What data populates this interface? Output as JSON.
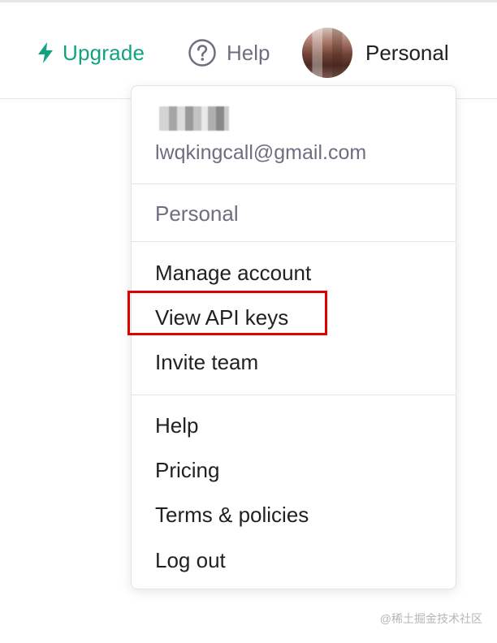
{
  "header": {
    "upgrade_label": "Upgrade",
    "help_label": "Help",
    "profile_label": "Personal",
    "upgrade_color": "#10a37f"
  },
  "menu": {
    "email": "lwqkingcall@gmail.com",
    "organization": "Personal",
    "items": [
      {
        "label": "Manage account"
      },
      {
        "label": "View API keys"
      },
      {
        "label": "Invite team"
      },
      {
        "label": "Help"
      },
      {
        "label": "Pricing"
      },
      {
        "label": "Terms & policies"
      },
      {
        "label": "Log out"
      }
    ]
  },
  "annotation": {
    "highlight_target": "View API keys",
    "highlight_color": "#e00000"
  },
  "watermark": "@稀土掘金技术社区",
  "icons": {
    "upgrade": "lightning-icon",
    "help": "help-circle-icon"
  }
}
